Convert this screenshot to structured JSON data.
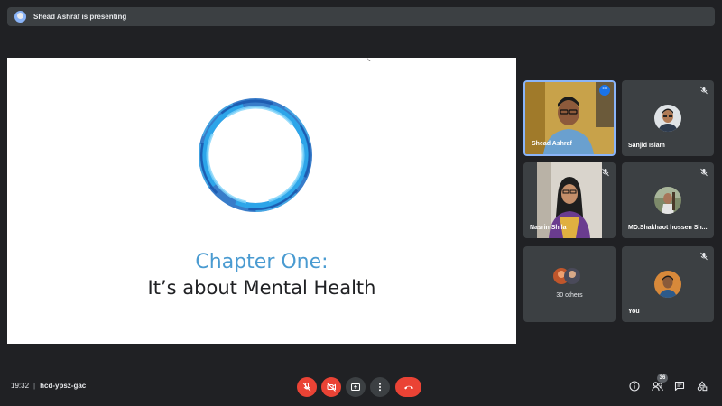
{
  "presenter_banner": {
    "text": "Shead Ashraf is presenting"
  },
  "slide": {
    "title": "Chapter One:",
    "subtitle": "It’s about Mental Health"
  },
  "participants": [
    {
      "name": "Shead Ashraf",
      "active_speaker": true,
      "muted": false
    },
    {
      "name": "Sanjid Islam",
      "muted": true
    },
    {
      "name": "Nasrin Shila",
      "muted": true
    },
    {
      "name": "MD.Shakhaot hossen Sh...",
      "muted": true
    },
    {
      "name": "30 others"
    },
    {
      "name": "You",
      "muted": true
    }
  ],
  "meeting": {
    "time": "19:32",
    "separator": "|",
    "code": "hcd-ypsz-gac"
  },
  "toolbar": {
    "more_dots": "•••"
  },
  "people_count": "36",
  "colors": {
    "end_call": "#ea4335",
    "active_border": "#8ab4f8",
    "tile_bg": "#3c4043",
    "stage_bg": "#202124"
  },
  "icons": [
    "mic-off-icon",
    "camera-off-icon",
    "present-icon",
    "more-vert-icon",
    "end-call-icon",
    "info-icon",
    "people-icon",
    "chat-icon",
    "activities-icon"
  ]
}
